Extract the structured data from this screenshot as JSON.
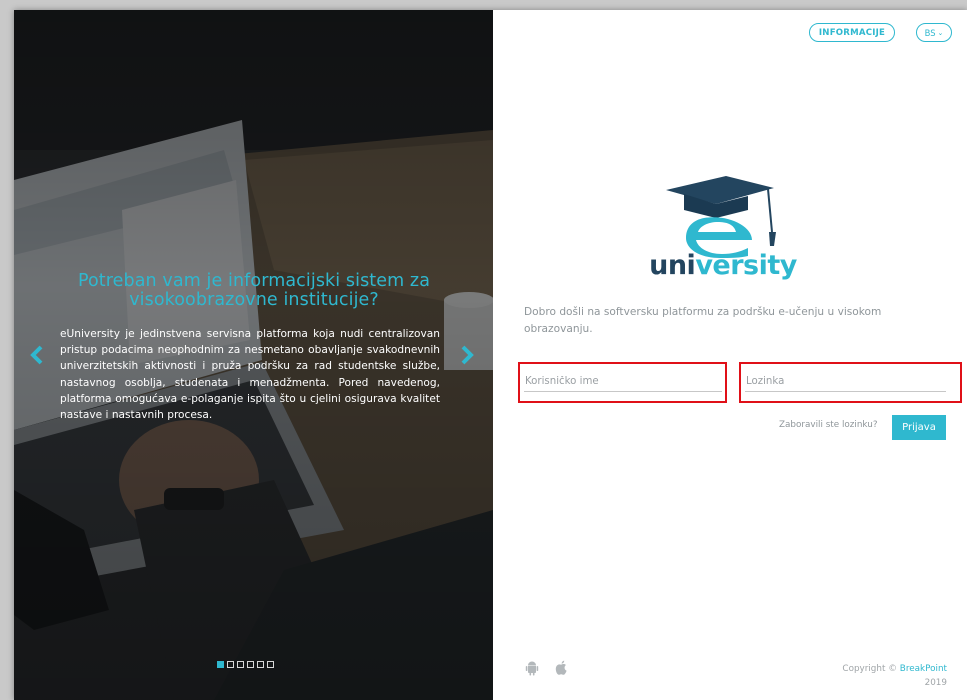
{
  "header": {
    "info_label": "INFORMACIJE",
    "language_label": "BS",
    "language_chevron": "chevron-down-icon"
  },
  "slider": {
    "title": "Potreban vam je informacijski sistem za visokoobrazovne institucije?",
    "text": "eUniversity je jedinstvena servisna platforma koja nudi centralizovan pristup podacima neophodnim za nesmetano obavljanje svakodnevnih univerzitetskih aktivnosti i pruža podršku za rad studentske službe, nastavnog osoblja, studenata i menadžmenta. Pored navedenog, platforma omogućava e-polaganje ispita što u cjelini osigurava kvalitet nastave i nastavnih procesa.",
    "slide_count": 6,
    "active_slide": 1,
    "prev_icon": "chevron-left-icon",
    "next_icon": "chevron-right-icon"
  },
  "logo": {
    "letter": "e",
    "part1": "uni",
    "part2": "versity",
    "icon": "graduation-cap-icon"
  },
  "login": {
    "welcome": "Dobro došli na softversku platformu za podršku e-učenju u visokom obrazovanju.",
    "username_placeholder": "Korisničko ime",
    "password_placeholder": "Lozinka",
    "forgot_label": "Zaboravili ste lozinku?",
    "submit_label": "Prijava"
  },
  "footer": {
    "copyright_prefix": "Copyright ©",
    "brand": "BreakPoint",
    "year": "2019",
    "icons": [
      "android-icon",
      "apple-icon"
    ]
  },
  "colors": {
    "accent": "#2fb8cf",
    "logo_dark": "#23455f",
    "highlight_red": "#e01018",
    "muted_text": "#8f969a"
  }
}
